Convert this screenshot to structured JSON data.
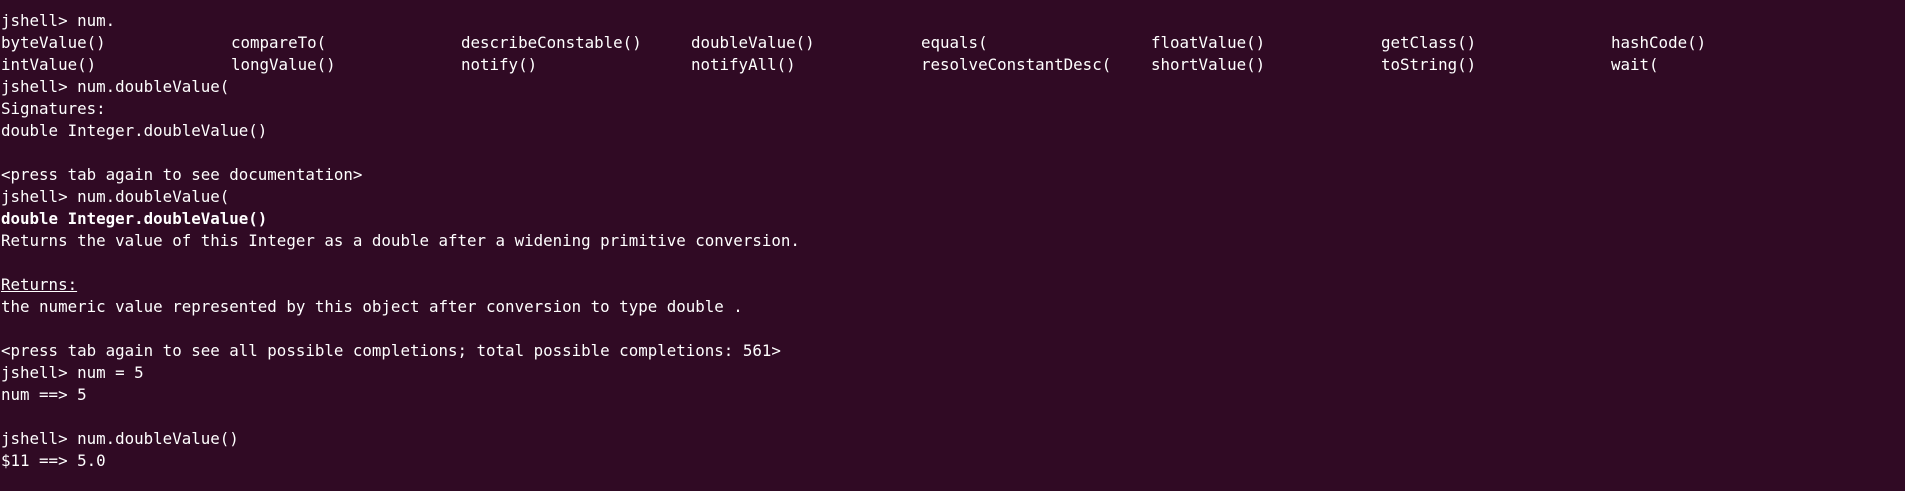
{
  "terminal": {
    "line1": "jshell> num.",
    "completions_row1": [
      "byteValue()",
      "compareTo(",
      "describeConstable()",
      "doubleValue()",
      "equals(",
      "floatValue()",
      "getClass()",
      "hashCode()"
    ],
    "completions_row2": [
      "intValue()",
      "longValue()",
      "notify()",
      "notifyAll()",
      "resolveConstantDesc(",
      "shortValue()",
      "toString()",
      "wait("
    ],
    "line4": "jshell> num.doubleValue(",
    "line5": "Signatures:",
    "line6": "double Integer.doubleValue()",
    "line8": "<press tab again to see documentation>",
    "line9": "jshell> num.doubleValue(",
    "line10": "double Integer.doubleValue()",
    "line11": "Returns the value of this Integer as a double after a widening primitive conversion.",
    "line13": "Returns:",
    "line14": "the numeric value represented by this object after conversion to type double .",
    "line16": "<press tab again to see all possible completions; total possible completions: 561>",
    "line17": "jshell> num = 5",
    "line18": "num ==> 5",
    "line20": "jshell> num.doubleValue()",
    "line21": "$11 ==> 5.0"
  }
}
